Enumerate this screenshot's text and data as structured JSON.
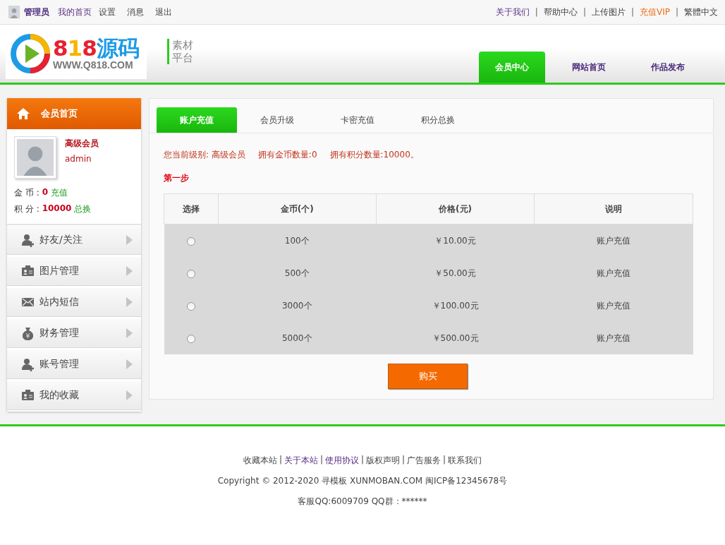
{
  "top_bar": {
    "left_links": [
      {
        "label": "管理员",
        "kind": "strong"
      },
      {
        "label": "我的首页",
        "kind": "visited"
      },
      {
        "label": "设置",
        "kind": "normal"
      },
      {
        "label": "消息",
        "kind": "normal"
      },
      {
        "label": "退出",
        "kind": "normal"
      }
    ],
    "right_links": [
      {
        "label": "关于我们",
        "kind": "visited"
      },
      {
        "label": "帮助中心",
        "kind": "normal"
      },
      {
        "label": "上传图片",
        "kind": "normal"
      },
      {
        "label": "充值VIP",
        "kind": "accent"
      },
      {
        "label": "繁體中文",
        "kind": "normal"
      }
    ],
    "separator": "|"
  },
  "header": {
    "logo": {
      "name": "818源码",
      "url": "WWW.Q818.COM"
    },
    "slogan": [
      "素材",
      "平台"
    ],
    "nav": [
      {
        "label": "会员中心",
        "selected": true
      },
      {
        "label": "网站首页",
        "selected": false
      },
      {
        "label": "作品发布",
        "selected": false
      }
    ]
  },
  "sidebar": {
    "title": "会员首页",
    "profile": {
      "level": "高级会员",
      "username": "admin",
      "coins_label": "金 币 :",
      "coins": "0",
      "coins_action": "充值",
      "points_label": "积 分 :",
      "points": "10000",
      "points_action": "总换"
    },
    "items": [
      {
        "label": "好友/关注",
        "selected": false
      },
      {
        "label": "图片管理",
        "selected": false
      },
      {
        "label": "站内短信",
        "selected": false
      },
      {
        "label": "财务管理",
        "selected": false
      },
      {
        "label": "账号管理",
        "selected": false
      },
      {
        "label": "我的收藏",
        "selected": false
      }
    ]
  },
  "panel": {
    "tabs": [
      {
        "label": "账户充值",
        "selected": true
      },
      {
        "label": "会员升级",
        "selected": false
      },
      {
        "label": "卡密充值",
        "selected": false
      },
      {
        "label": "积分总换",
        "selected": false
      }
    ],
    "status": [
      "您当前级别: 高级会员",
      "拥有金币数量:0",
      "拥有积分数量:10000。"
    ],
    "step": "第一步",
    "table": {
      "columns": [
        "选择",
        "金币(个)",
        "价格(元)",
        "说明"
      ],
      "rows": [
        {
          "selected": false,
          "coins": "100个",
          "price": "￥10.00元",
          "note": "账户充值"
        },
        {
          "selected": false,
          "coins": "500个",
          "price": "￥50.00元",
          "note": "账户充值"
        },
        {
          "selected": false,
          "coins": "3000个",
          "price": "￥100.00元",
          "note": "账户充值"
        },
        {
          "selected": false,
          "coins": "5000个",
          "price": "￥500.00元",
          "note": "账户充值"
        }
      ]
    },
    "buy_button": "购买"
  },
  "footer": {
    "links": [
      {
        "label": "收藏本站",
        "visited": false
      },
      {
        "label": "关于本站",
        "visited": true
      },
      {
        "label": "使用协议",
        "visited": true
      },
      {
        "label": "版权声明",
        "visited": false
      },
      {
        "label": "广告服务",
        "visited": false
      },
      {
        "label": "联系我们",
        "visited": false
      }
    ],
    "separator": "|",
    "copyright": "Copyright © 2012-2020 寻模板 XUNMOBAN.COM 闽ICP备12345678号",
    "contact": "客服QQ:6009709 QQ群：******"
  }
}
